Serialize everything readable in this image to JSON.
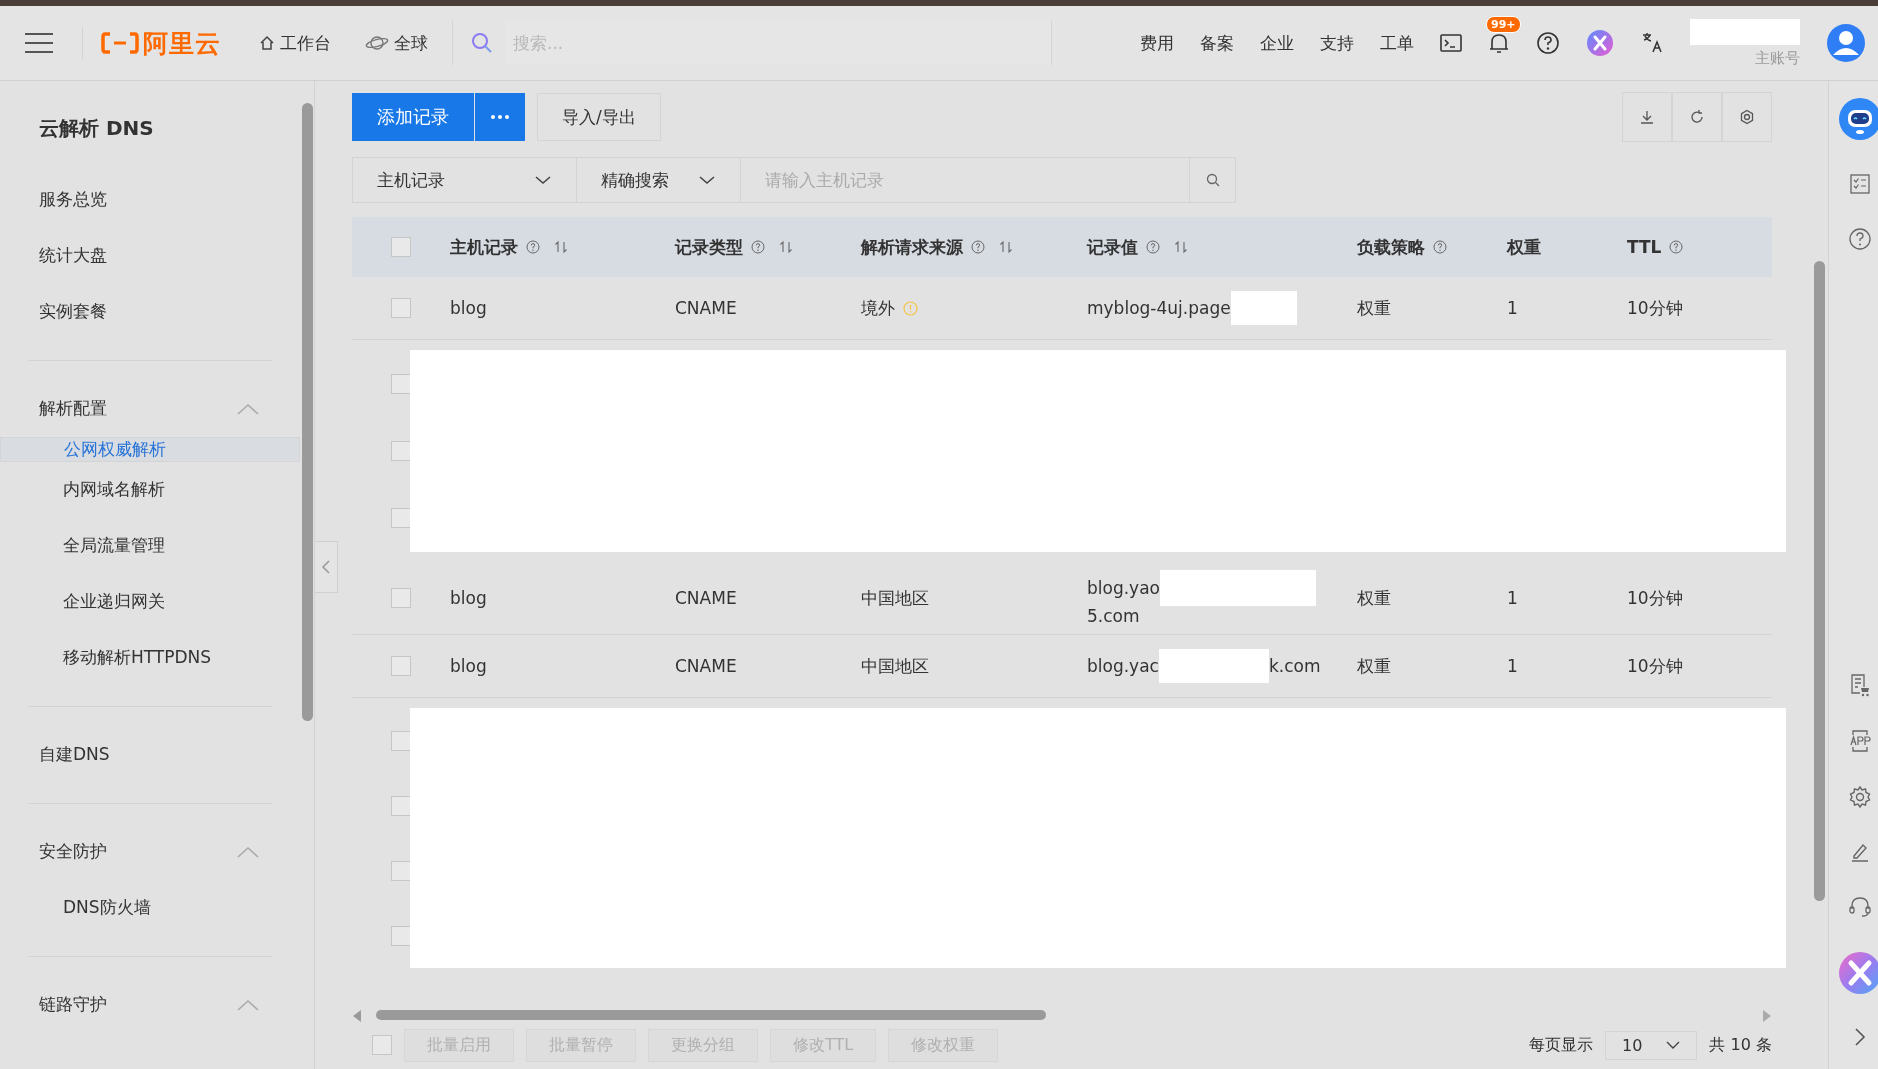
{
  "top_bar": {
    "logo": "阿里云",
    "workbench": "工作台",
    "region": "全球",
    "search": {
      "placeholder": "搜索..."
    },
    "nav": [
      "费用",
      "备案",
      "企业",
      "支持",
      "工单"
    ],
    "notification_badge": "99+",
    "account_label": "主账号"
  },
  "sidebar": {
    "title": "云解析 DNS",
    "sections": [
      {
        "kind": "items",
        "items": [
          {
            "label": "服务总览",
            "selected": false
          },
          {
            "label": "统计大盘",
            "selected": false
          },
          {
            "label": "实例套餐",
            "selected": false
          }
        ]
      },
      {
        "kind": "group",
        "label": "解析配置",
        "expanded": true,
        "children": [
          {
            "label": "公网权威解析",
            "selected": true
          },
          {
            "label": "内网域名解析",
            "selected": false
          },
          {
            "label": "全局流量管理",
            "selected": false
          },
          {
            "label": "企业递归网关",
            "selected": false
          },
          {
            "label": "移动解析HTTPDNS",
            "selected": false
          }
        ]
      },
      {
        "kind": "items",
        "items": [
          {
            "label": "自建DNS",
            "selected": false
          }
        ]
      },
      {
        "kind": "group",
        "label": "安全防护",
        "expanded": true,
        "children": [
          {
            "label": "DNS防火墙",
            "selected": false
          }
        ]
      },
      {
        "kind": "group",
        "label": "链路守护",
        "expanded": true
      }
    ]
  },
  "toolbar": {
    "primary": "添加记录",
    "secondary": "导入/导出"
  },
  "filter": {
    "field": "主机记录",
    "mode": "精确搜索",
    "search": {
      "placeholder": "请输入主机记录"
    }
  },
  "table": {
    "select_all_checked": false,
    "columns": [
      {
        "label": "主机记录",
        "help": true,
        "sortable": true
      },
      {
        "label": "记录类型",
        "help": true,
        "sortable": true
      },
      {
        "label": "解析请求来源",
        "help": true,
        "sortable": true
      },
      {
        "label": "记录值",
        "help": true,
        "sortable": true
      },
      {
        "label": "负载策略",
        "help": true,
        "sortable": false
      },
      {
        "label": "权重",
        "help": false,
        "sortable": false
      },
      {
        "label": "TTL",
        "help": true,
        "sortable": false
      }
    ],
    "body": [
      {
        "kind": "row",
        "checked": false,
        "host": "blog",
        "type": "CNAME",
        "source": "境外",
        "source_warning": true,
        "value_lines": [
          [
            {
              "kind": "text",
              "text": "myblog-4uj.page"
            },
            {
              "kind": "redaction"
            }
          ]
        ],
        "policy": "权重",
        "weight": "1",
        "ttl": "10分钟"
      },
      {
        "kind": "redacted",
        "checkboxes": [
          {
            "checked": false
          },
          {
            "checked": false
          },
          {
            "checked": false
          }
        ]
      },
      {
        "kind": "row",
        "checked": false,
        "host": "blog",
        "type": "CNAME",
        "source": "中国地区",
        "source_warning": false,
        "value_lines": [
          [
            {
              "kind": "text",
              "text": "blog.yao"
            },
            {
              "kind": "redaction"
            }
          ],
          [
            {
              "kind": "text",
              "text": "5.com"
            }
          ]
        ],
        "policy": "权重",
        "weight": "1",
        "ttl": "10分钟"
      },
      {
        "kind": "row",
        "checked": false,
        "host": "blog",
        "type": "CNAME",
        "source": "中国地区",
        "source_warning": false,
        "value_lines": [
          [
            {
              "kind": "text",
              "text": "blog.yac"
            },
            {
              "kind": "redaction"
            },
            {
              "kind": "text",
              "text": "k.com"
            }
          ]
        ],
        "policy": "权重",
        "weight": "1",
        "ttl": "10分钟"
      },
      {
        "kind": "redacted",
        "checkboxes": [
          {
            "checked": false
          },
          {
            "checked": false
          },
          {
            "checked": false
          },
          {
            "checked": false
          }
        ]
      }
    ]
  },
  "footer_checked": false,
  "batch_actions": [
    {
      "label": "批量启用",
      "disabled": true
    },
    {
      "label": "批量暂停",
      "disabled": true
    },
    {
      "label": "更换分组",
      "disabled": true
    },
    {
      "label": "修改TTL",
      "disabled": true
    },
    {
      "label": "修改权重",
      "disabled": true
    }
  ],
  "pagination": {
    "page_size_label": "每页显示",
    "page_size": "10",
    "total": "共 10 条"
  }
}
